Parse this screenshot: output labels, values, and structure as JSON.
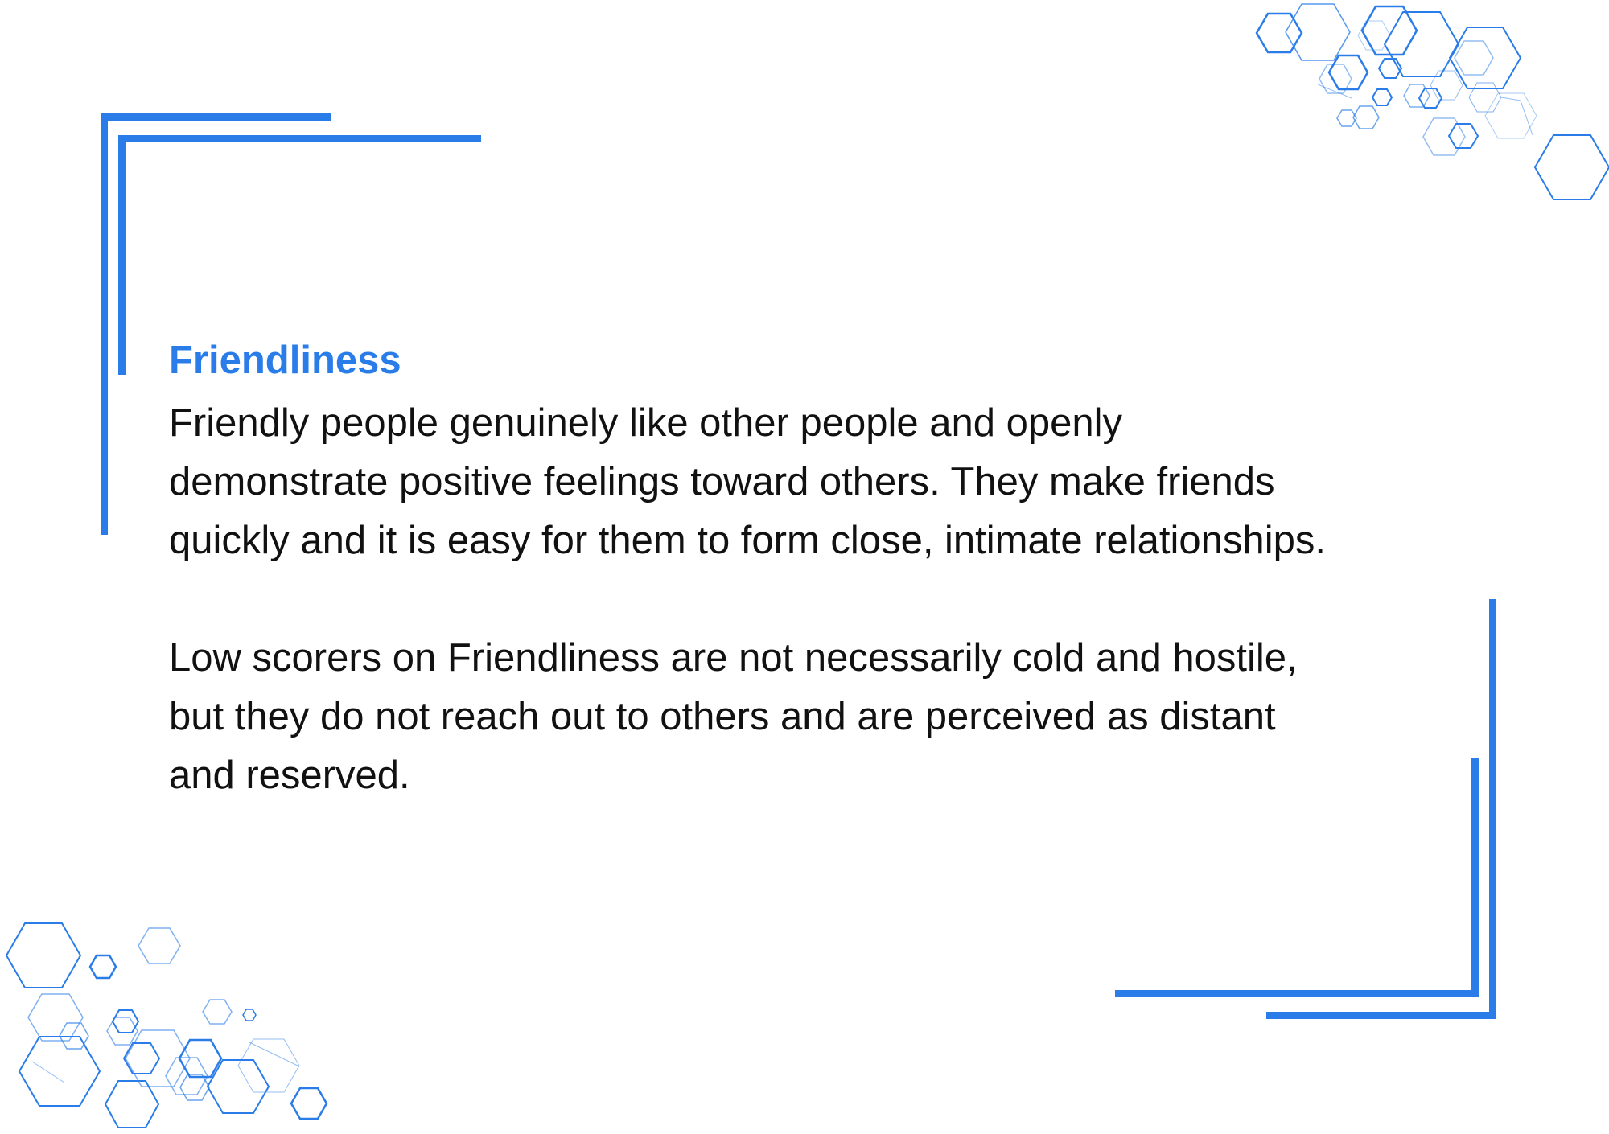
{
  "heading": "Friendliness",
  "paragraphs": [
    "Friendly people genuinely like other people and openly\ndemonstrate positive feelings toward others. They make friends\nquickly and it is easy for them to form close, intimate relationships.",
    "Low scorers on Friendliness are not necessarily cold and hostile,\nbut they do not reach out to others and are perceived as distant\nand reserved."
  ],
  "colors": {
    "accent": "#2a7de9",
    "text": "#111111",
    "background": "#ffffff"
  }
}
